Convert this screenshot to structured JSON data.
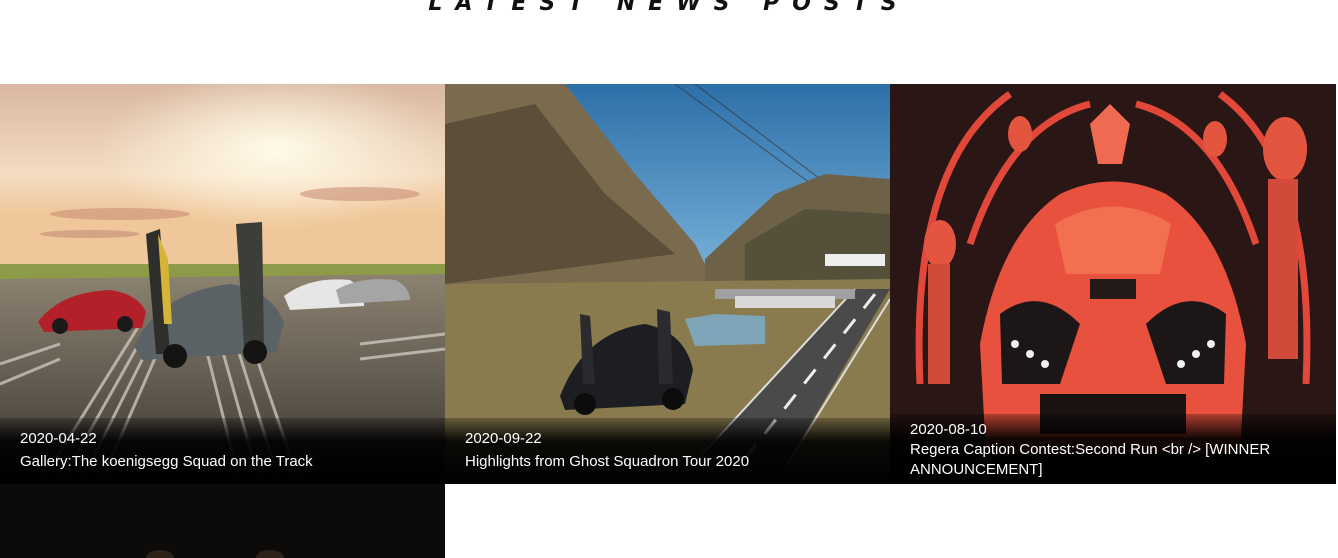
{
  "section": {
    "title": "LATEST NEWS POSTS"
  },
  "posts": [
    {
      "date": "2020-04-22",
      "title": "Gallery:The koenigsegg Squad on the Track"
    },
    {
      "date": "2020-09-22",
      "title": "Highlights from Ghost Squadron Tour 2020"
    },
    {
      "date": "2020-08-10",
      "title": "Regera Caption Contest:Second Run <br /> [WINNER ANNOUNCEMENT]"
    }
  ]
}
